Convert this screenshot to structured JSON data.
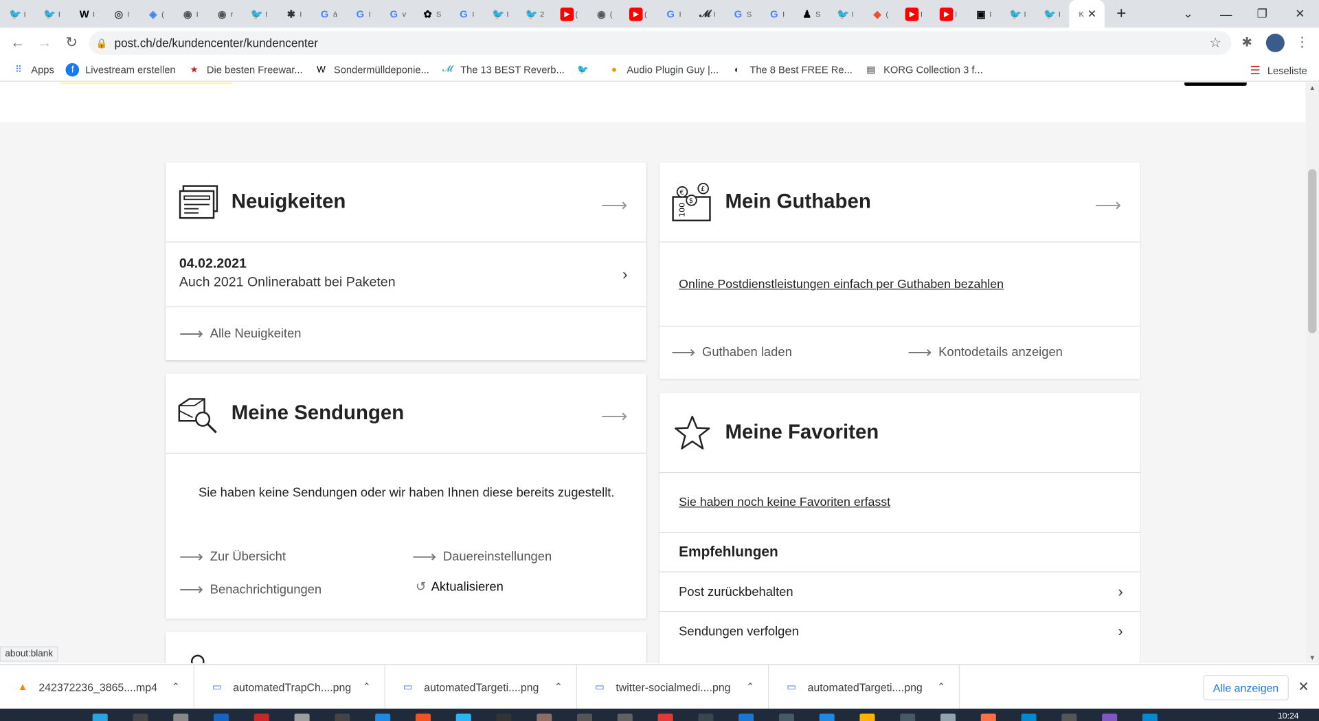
{
  "browser": {
    "tabs": [
      {
        "icon": "twitter-icon",
        "letter": "I",
        "color": "#1da1f2"
      },
      {
        "icon": "twitter-icon",
        "letter": "I",
        "color": "#1da1f2"
      },
      {
        "icon": "wikipedia-icon",
        "letter": "I",
        "color": "#000"
      },
      {
        "icon": "chrome-icon",
        "letter": "I",
        "color": "#444"
      },
      {
        "icon": "translate-icon",
        "letter": "(",
        "color": "#4285f4"
      },
      {
        "icon": "globe-icon",
        "letter": "I",
        "color": "#555"
      },
      {
        "icon": "globe-icon",
        "letter": "r",
        "color": "#555"
      },
      {
        "icon": "twitter-icon",
        "letter": "I",
        "color": "#1da1f2"
      },
      {
        "icon": "gear-icon",
        "letter": "I",
        "color": "#333"
      },
      {
        "icon": "google-icon",
        "letter": "á",
        "color": "#4285f4"
      },
      {
        "icon": "google-icon",
        "letter": "I",
        "color": "#4285f4"
      },
      {
        "icon": "google-icon",
        "letter": "v",
        "color": "#4285f4"
      },
      {
        "icon": "app-icon",
        "letter": "S",
        "color": "#000"
      },
      {
        "icon": "google-icon",
        "letter": "I",
        "color": "#4285f4"
      },
      {
        "icon": "twitter-icon",
        "letter": "I",
        "color": "#1da1f2"
      },
      {
        "icon": "twitter-icon",
        "letter": "2",
        "color": "#1da1f2"
      },
      {
        "icon": "youtube-icon",
        "letter": "(",
        "color": "#ff0000"
      },
      {
        "icon": "globe-icon",
        "letter": "(",
        "color": "#555"
      },
      {
        "icon": "youtube-icon",
        "letter": "(",
        "color": "#ff0000"
      },
      {
        "icon": "google-icon",
        "letter": "I",
        "color": "#4285f4"
      },
      {
        "icon": "script-icon",
        "letter": "I",
        "color": "#333"
      },
      {
        "icon": "google-icon",
        "letter": "S",
        "color": "#4285f4"
      },
      {
        "icon": "google-icon",
        "letter": "I",
        "color": "#4285f4"
      },
      {
        "icon": "figure-icon",
        "letter": "S",
        "color": "#000"
      },
      {
        "icon": "twitter-icon",
        "letter": "I",
        "color": "#1da1f2"
      },
      {
        "icon": "git-icon",
        "letter": "(",
        "color": "#f05032"
      },
      {
        "icon": "youtube-icon",
        "letter": "I",
        "color": "#ff0000"
      },
      {
        "icon": "youtube-icon",
        "letter": "I",
        "color": "#ff0000"
      },
      {
        "icon": "box-icon",
        "letter": "I",
        "color": "#000"
      },
      {
        "icon": "twitter-icon",
        "letter": "I",
        "color": "#1da1f2"
      },
      {
        "icon": "twitter-icon",
        "letter": "I",
        "color": "#1da1f2"
      }
    ],
    "active_tab_letter": "K",
    "url": "post.ch/de/kundencenter/kundencenter",
    "bookmarks": [
      {
        "label": "Apps",
        "icon": "apps-grid-icon"
      },
      {
        "label": "Livestream erstellen",
        "icon": "facebook-icon"
      },
      {
        "label": "Die besten Freewar...",
        "icon": "star-red-icon"
      },
      {
        "label": "Sondermülldeponie...",
        "icon": "wikipedia-icon"
      },
      {
        "label": "The 13 BEST Reverb...",
        "icon": "m-script-icon"
      },
      {
        "label": "",
        "icon": "twitter-icon"
      },
      {
        "label": "Audio Plugin Guy |...",
        "icon": "plugin-icon"
      },
      {
        "label": "The 8 Best FREE Re...",
        "icon": "moon-icon"
      },
      {
        "label": "KORG Collection 3 f...",
        "icon": "korg-icon"
      }
    ],
    "reading_list": "Leseliste",
    "status_text": "about:blank"
  },
  "neuigkeiten": {
    "title": "Neuigkeiten",
    "date": "04.02.2021",
    "headline": "Auch 2021 Onlinerabatt bei Paketen",
    "all_link": "Alle Neuigkeiten"
  },
  "guthaben": {
    "title": "Mein Guthaben",
    "link": "Online Postdienstleistungen einfach per Guthaben bezahlen",
    "action_load": "Guthaben laden",
    "action_details": "Kontodetails anzeigen"
  },
  "sendungen": {
    "title": "Meine Sendungen",
    "empty_text": "Sie haben keine Sendungen oder wir haben Ihnen diese bereits zugestellt.",
    "link_overview": "Zur Übersicht",
    "link_permanent": "Dauereinstellungen",
    "link_notifications": "Benachrichtigungen",
    "link_refresh": "Aktualisieren"
  },
  "favoriten": {
    "title": "Meine Favoriten",
    "empty_link": "Sie haben noch keine Favoriten erfasst",
    "recommendations_title": "Empfehlungen",
    "recommendations": [
      "Post zurückbehalten",
      "Sendungen verfolgen"
    ]
  },
  "downloads": {
    "items": [
      {
        "name": "242372236_3865....mp4",
        "icon": "vlc-icon"
      },
      {
        "name": "automatedTrapCh....png",
        "icon": "image-file-icon"
      },
      {
        "name": "automatedTargeti....png",
        "icon": "image-file-icon"
      },
      {
        "name": "twitter-socialmedi....png",
        "icon": "image-file-icon"
      },
      {
        "name": "automatedTargeti....png",
        "icon": "image-file-icon"
      }
    ],
    "show_all": "Alle anzeigen"
  },
  "taskbar": {
    "clock": "10:24"
  }
}
